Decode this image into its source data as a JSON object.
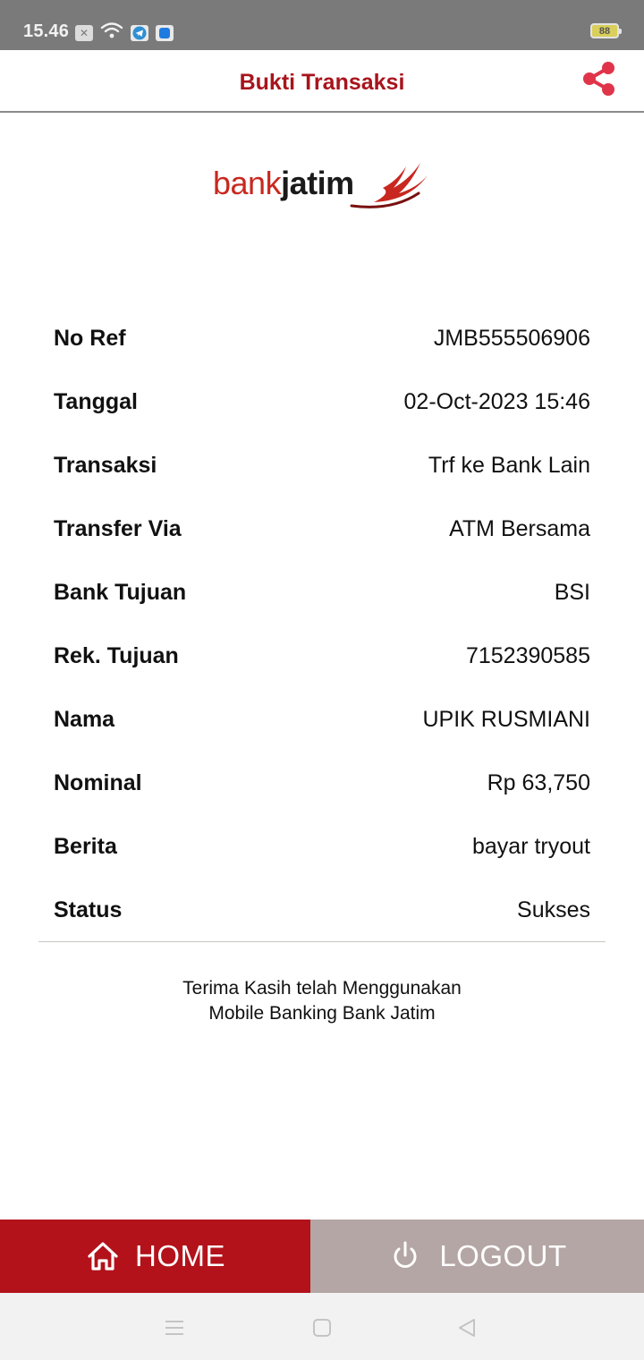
{
  "status_bar": {
    "time": "15.46",
    "battery": "88",
    "icons": [
      "notification-x-icon",
      "wifi-icon",
      "telegram-icon",
      "app-icon"
    ]
  },
  "header": {
    "title": "Bukti Transaksi",
    "share_icon": "share-icon",
    "accent_color": "#a8141c"
  },
  "logo": {
    "part1": "bank",
    "part2": "jatim"
  },
  "details": [
    {
      "label": "No Ref",
      "value": "JMB555506906"
    },
    {
      "label": "Tanggal",
      "value": "02-Oct-2023 15:46"
    },
    {
      "label": "Transaksi",
      "value": "Trf ke Bank Lain"
    },
    {
      "label": "Transfer Via",
      "value": "ATM Bersama"
    },
    {
      "label": "Bank Tujuan",
      "value": "BSI"
    },
    {
      "label": "Rek. Tujuan",
      "value": "7152390585"
    },
    {
      "label": "Nama",
      "value": "UPIK RUSMIANI"
    },
    {
      "label": "Nominal",
      "value": "Rp 63,750"
    },
    {
      "label": "Berita",
      "value": "bayar tryout"
    },
    {
      "label": "Status",
      "value": "Sukses"
    }
  ],
  "thanks": {
    "line1": "Terima Kasih telah Menggunakan",
    "line2": "Mobile Banking Bank Jatim"
  },
  "buttons": {
    "home": {
      "label": "HOME",
      "icon": "home-icon",
      "color": "#b3121a"
    },
    "logout": {
      "label": "LOGOUT",
      "icon": "power-icon",
      "color": "#b4a6a4"
    }
  },
  "nav": {
    "icons": [
      "menu-icon",
      "home-square-icon",
      "back-icon"
    ]
  }
}
